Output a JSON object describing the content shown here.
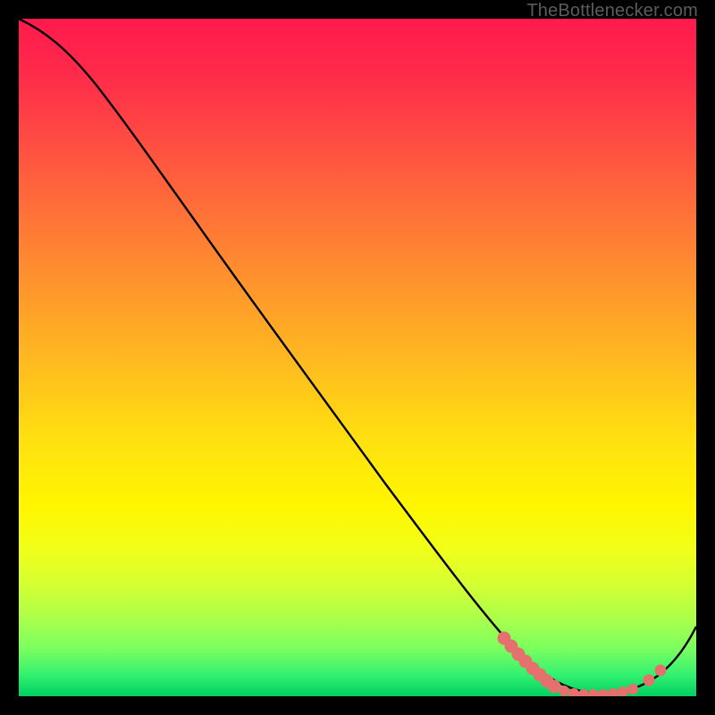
{
  "branding": {
    "site": "TheBottlenecker.com"
  },
  "chart_data": {
    "type": "line",
    "title": "",
    "xlabel": "",
    "ylabel": "",
    "x_range": [
      0,
      100
    ],
    "y_range": [
      0,
      100
    ],
    "series": [
      {
        "name": "curve",
        "x": [
          0,
          6,
          12,
          18,
          24,
          30,
          36,
          42,
          48,
          54,
          60,
          66,
          72,
          78,
          82,
          86,
          90,
          94,
          98,
          100
        ],
        "y": [
          100,
          98,
          93,
          86,
          78,
          70,
          62,
          54,
          46,
          38,
          30,
          22,
          14,
          6,
          2,
          0,
          0,
          2,
          8,
          12
        ]
      }
    ],
    "markers": {
      "name": "highlight-points",
      "color": "#e66a6a",
      "x": [
        72,
        73,
        74,
        75,
        76,
        77,
        78,
        79,
        80,
        82,
        84,
        86,
        88,
        90,
        92,
        94,
        96
      ],
      "y": [
        13,
        11,
        9,
        7,
        6,
        5,
        4,
        3,
        2,
        1,
        0,
        0,
        0,
        0,
        1,
        3,
        6
      ]
    }
  }
}
